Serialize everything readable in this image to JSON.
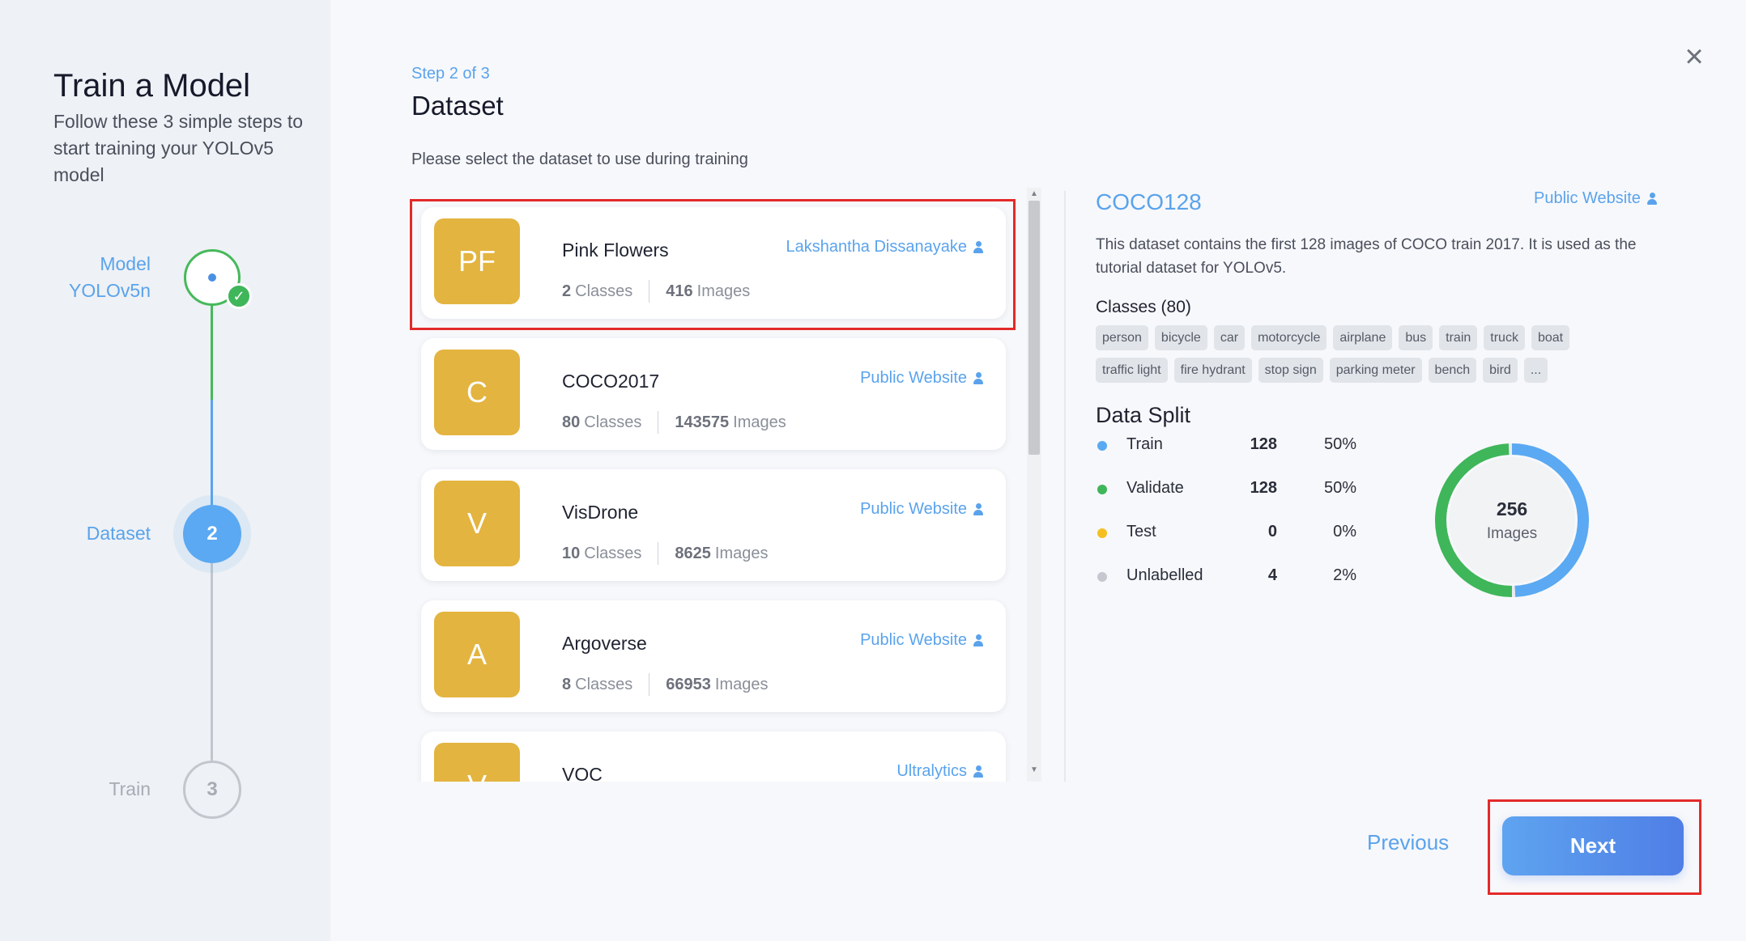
{
  "sidebar": {
    "title": "Train a Model",
    "subtitle": "Follow these 3 simple steps to start training your YOLOv5 model",
    "steps": [
      {
        "label_line1": "Model",
        "label_line2": "YOLOv5n",
        "number": "",
        "state": "done"
      },
      {
        "label_line1": "Dataset",
        "number": "2",
        "state": "active"
      },
      {
        "label_line1": "Train",
        "number": "3",
        "state": "pending"
      }
    ]
  },
  "header": {
    "step_of": "Step 2 of 3",
    "title": "Dataset",
    "instruction": "Please select the dataset to use during training",
    "close_icon": "close-icon"
  },
  "datasets": [
    {
      "initials": "PF",
      "name": "Pink Flowers",
      "owner": "Lakshantha Dissanayake",
      "classes": "2",
      "classes_label": "Classes",
      "images": "416",
      "images_label": "Images",
      "selected": true
    },
    {
      "initials": "C",
      "name": "COCO2017",
      "owner": "Public Website",
      "classes": "80",
      "classes_label": "Classes",
      "images": "143575",
      "images_label": "Images"
    },
    {
      "initials": "V",
      "name": "VisDrone",
      "owner": "Public Website",
      "classes": "10",
      "classes_label": "Classes",
      "images": "8625",
      "images_label": "Images"
    },
    {
      "initials": "A",
      "name": "Argoverse",
      "owner": "Public Website",
      "classes": "8",
      "classes_label": "Classes",
      "images": "66953",
      "images_label": "Images"
    },
    {
      "initials": "V",
      "name": "VOC",
      "owner": "Ultralytics",
      "classes": "",
      "classes_label": "",
      "images": "",
      "images_label": ""
    }
  ],
  "detail": {
    "name": "COCO128",
    "owner": "Public Website",
    "description": "This dataset contains the first 128 images of COCO train 2017. It is used as the tutorial dataset for YOLOv5.",
    "classes_label": "Classes (80)",
    "tags": [
      "person",
      "bicycle",
      "car",
      "motorcycle",
      "airplane",
      "bus",
      "train",
      "truck",
      "boat",
      "traffic light",
      "fire hydrant",
      "stop sign",
      "parking meter",
      "bench",
      "bird",
      "..."
    ],
    "split_title": "Data Split",
    "split": [
      {
        "label": "Train",
        "count": "128",
        "pct": "50%",
        "color": "#5aa9f2"
      },
      {
        "label": "Validate",
        "count": "128",
        "pct": "50%",
        "color": "#3fb65a"
      },
      {
        "label": "Test",
        "count": "0",
        "pct": "0%",
        "color": "#f4c021"
      },
      {
        "label": "Unlabelled",
        "count": "4",
        "pct": "2%",
        "color": "#c5c8ce"
      }
    ],
    "donut": {
      "total": "256",
      "unit": "Images",
      "train_fraction": 0.5,
      "validate_fraction": 0.5
    }
  },
  "footer": {
    "previous_label": "Previous",
    "next_label": "Next"
  }
}
